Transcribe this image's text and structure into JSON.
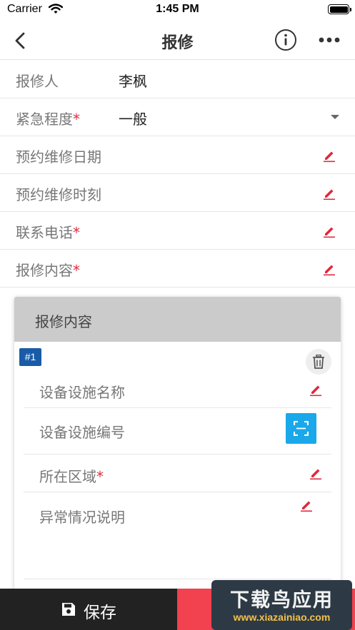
{
  "status_bar": {
    "carrier": "Carrier",
    "time": "1:45 PM"
  },
  "nav": {
    "title": "报修"
  },
  "form": {
    "reporter": {
      "label": "报修人",
      "value": "李枫"
    },
    "urgency": {
      "label": "紧急程度",
      "required_mark": "*",
      "value": "一般"
    },
    "appointment_date": {
      "label": "预约维修日期"
    },
    "appointment_time": {
      "label": "预约维修时刻"
    },
    "phone": {
      "label": "联系电话",
      "required_mark": "*"
    },
    "content": {
      "label": "报修内容",
      "required_mark": "*"
    }
  },
  "card": {
    "title": "报修内容",
    "item_index": "#1",
    "fields": {
      "equipment_name": {
        "label": "设备设施名称"
      },
      "equipment_code": {
        "label": "设备设施编号"
      },
      "area": {
        "label": "所在区域",
        "required_mark": "*"
      },
      "description": {
        "label": "异常情况说明"
      }
    }
  },
  "bottom": {
    "save_label": "保存"
  },
  "watermark": {
    "title": "下载鸟应用",
    "subtitle": "www.xiazainiao.com"
  },
  "colors": {
    "accent_red": "#f2414f",
    "required": "#e02b3c",
    "badge_blue": "#1a5ba8",
    "scan_blue": "#1aa8ea",
    "dark": "#222222"
  },
  "icons": [
    "wifi-icon",
    "battery-icon",
    "back-icon",
    "info-icon",
    "more-icon",
    "caret-down-icon",
    "edit-icon",
    "trash-icon",
    "scan-icon",
    "save-icon"
  ]
}
